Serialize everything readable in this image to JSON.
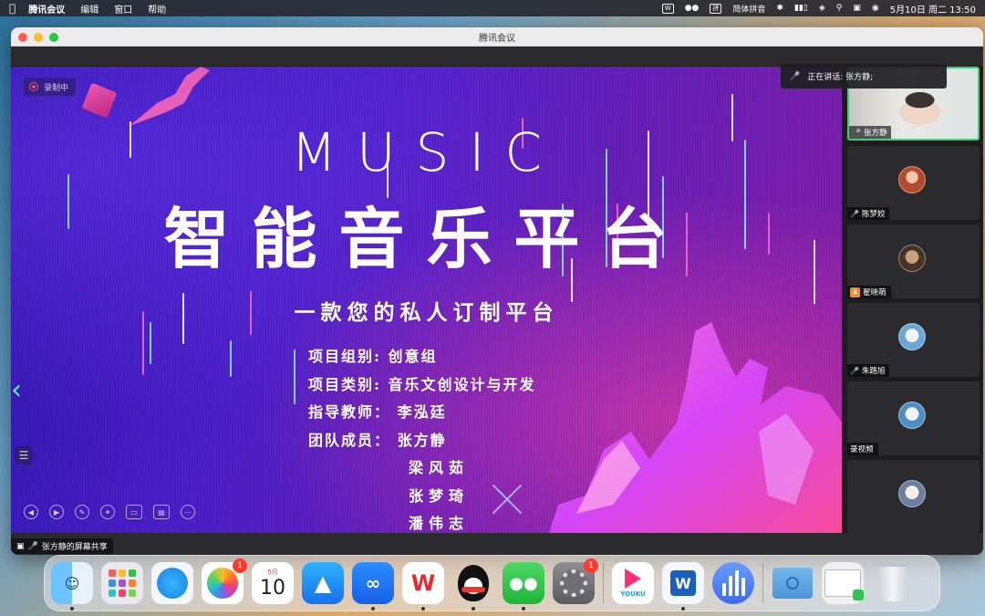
{
  "menubar": {
    "app_name": "腾讯会议",
    "menus": [
      "编辑",
      "窗口",
      "帮助"
    ],
    "status": {
      "input_method": "简体拼音",
      "clock": "5月10日 周二 13:50"
    }
  },
  "window": {
    "title": "腾讯会议"
  },
  "slide": {
    "recording_label": "录制中",
    "heading_en": "MUSIC",
    "heading_cn": "智能音乐平台",
    "subtitle": "一款您的私人订制平台",
    "info_rows": [
      "项目组别: 创意组",
      "项目类别: 音乐文创设计与开发",
      "指导教师： 李泓廷",
      "团队成员： 张方静"
    ],
    "members": [
      "梁风茹",
      "张梦琦",
      "潘伟志"
    ]
  },
  "share": {
    "label": "张方静的屏幕共享"
  },
  "speaking": {
    "label": "正在讲话: 张方静;"
  },
  "participants": [
    {
      "name": "张方静",
      "mic": "on",
      "video": true
    },
    {
      "name": "陈梦姣",
      "mic": "muted",
      "video": false
    },
    {
      "name": "翟晓萌",
      "mic": "none",
      "video": false
    },
    {
      "name": "朱路旭",
      "mic": "muted",
      "video": false
    },
    {
      "name": "录视频",
      "mic": "none",
      "video": false
    },
    {
      "name": "",
      "mic": "none",
      "video": false
    }
  ],
  "dock": {
    "photos_badge": "1",
    "calendar_month": "5月",
    "calendar_day": "10",
    "settings_badge": "1",
    "youku_label": "YOUKU",
    "colors": {
      "accent_green": "#3fcf7a",
      "badge_red": "#ff3b30"
    }
  }
}
